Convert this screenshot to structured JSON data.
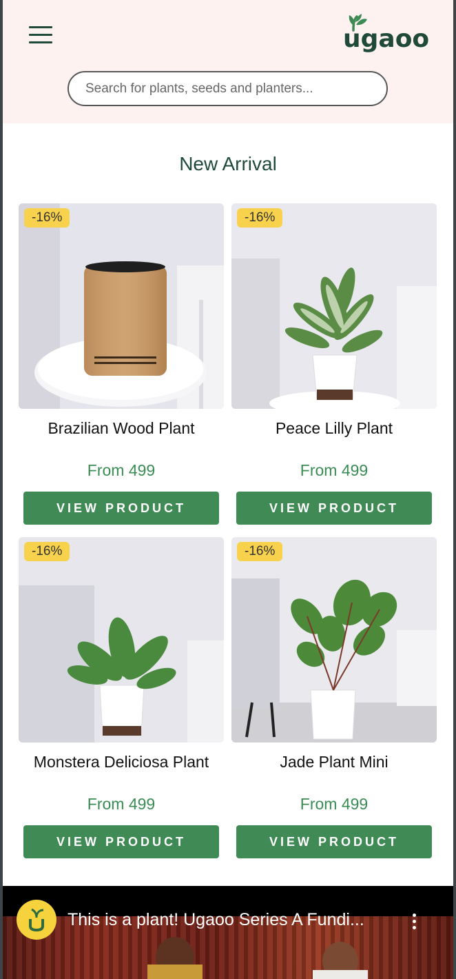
{
  "header": {
    "logo_text": "ugaoo",
    "search_placeholder": "Search for plants, seeds and planters..."
  },
  "section": {
    "title": "New Arrival"
  },
  "products": [
    {
      "badge": "-16%",
      "name": "Brazilian Wood Plant",
      "price": "From 499",
      "button": "VIEW PRODUCT",
      "image": "ubreathe-mini-purifier"
    },
    {
      "badge": "-16%",
      "name": "Peace Lilly Plant",
      "price": "From 499",
      "button": "VIEW PRODUCT",
      "image": "peace-lily-pot"
    },
    {
      "badge": "-16%",
      "name": "Monstera Deliciosa Plant",
      "price": "From 499",
      "button": "VIEW PRODUCT",
      "image": "monstera-pot"
    },
    {
      "badge": "-16%",
      "name": "Jade Plant Mini",
      "price": "From 499",
      "button": "VIEW PRODUCT",
      "image": "tall-plant-pot"
    }
  ],
  "video": {
    "title": "This is a plant! Ugaoo Series A Fundi...",
    "channel_icon": "ugaoo-u-icon",
    "menu_icon": "more-vertical-icon"
  },
  "colors": {
    "brand_dark_green": "#1f4a3a",
    "button_green": "#3f8a55",
    "price_green": "#3a8c55",
    "badge_yellow": "#f8d24c",
    "header_bg": "#fdf2f0"
  }
}
